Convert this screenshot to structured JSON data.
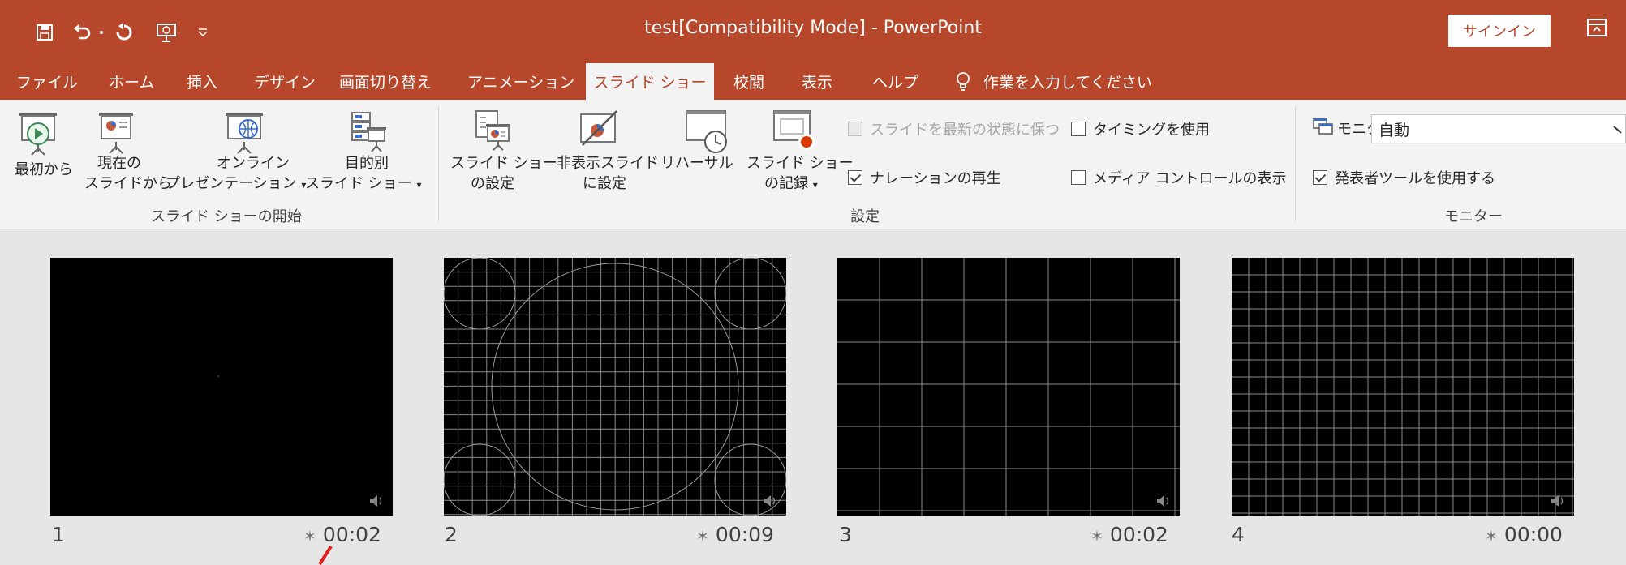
{
  "window": {
    "title": "test[Compatibility Mode]  -  PowerPoint",
    "signin_label": "サインイン",
    "accent_color": "#b7472a",
    "qat": {
      "save_icon": "save-icon",
      "undo_icon": "undo-icon",
      "undo_dropdown_icon": "dropdown-small-icon",
      "redo_icon": "repeat-icon",
      "from_beginning_icon": "start-from-beginning-icon",
      "customize_icon": "customize-qat-icon"
    }
  },
  "tabs": [
    {
      "label": "ファイル",
      "active": false
    },
    {
      "label": "ホーム",
      "active": false
    },
    {
      "label": "挿入",
      "active": false
    },
    {
      "label": "デザイン",
      "active": false
    },
    {
      "label": "画面切り替え",
      "active": false
    },
    {
      "label": "アニメーション",
      "active": false
    },
    {
      "label": "スライド ショー",
      "active": true
    },
    {
      "label": "校閲",
      "active": false
    },
    {
      "label": "表示",
      "active": false
    },
    {
      "label": "ヘルプ",
      "active": false
    }
  ],
  "tell_me": "作業を入力してください",
  "ribbon": {
    "start_group": {
      "label": "スライド ショーの開始",
      "from_beginning": "最初から",
      "from_current_1": "現在の",
      "from_current_2": "スライドから",
      "online_1": "オンライン",
      "online_2": "プレゼンテーション",
      "custom_1": "目的別",
      "custom_2": "スライド ショー"
    },
    "setup_group": {
      "label": "設定",
      "setup_1": "スライド ショー",
      "setup_2": "の設定",
      "hide_1": "非表示スライド",
      "hide_2": "に設定",
      "rehearse": "リハーサル",
      "record_1": "スライド ショー",
      "record_2": "の記録",
      "keep_updated": "スライドを最新の状態に保つ",
      "keep_updated_checked": false,
      "use_timings": "タイミングを使用",
      "use_timings_checked": false,
      "play_narrations": "ナレーションの再生",
      "play_narrations_checked": true,
      "show_media_controls": "メディア コントロールの表示",
      "show_media_controls_checked": false
    },
    "monitor_group": {
      "label": "モニター",
      "monitor_label": "モニター:",
      "monitor_value": "自動",
      "presenter_view": "発表者ツールを使用する",
      "presenter_view_checked": true
    }
  },
  "slides": [
    {
      "number": "1",
      "time": "00:02",
      "pattern": "blank"
    },
    {
      "number": "2",
      "time": "00:09",
      "pattern": "grid-circles"
    },
    {
      "number": "3",
      "time": "00:02",
      "pattern": "grid-coarse"
    },
    {
      "number": "4",
      "time": "00:00",
      "pattern": "grid-fine"
    }
  ]
}
